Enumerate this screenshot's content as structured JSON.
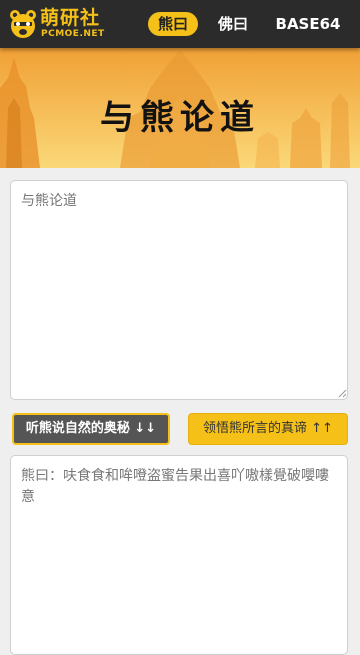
{
  "colors": {
    "accent": "#f5c018",
    "nav_bg": "#2b2b2b",
    "encode_btn_bg": "#555555"
  },
  "logo": {
    "title": "萌研社",
    "subtitle": "PCMOE.NET",
    "mascot_icon": "bear-mascot-icon"
  },
  "nav": {
    "tabs": [
      {
        "label": "熊曰",
        "active": true
      },
      {
        "label": "佛曰",
        "active": false
      },
      {
        "label": "BASE64",
        "active": false
      }
    ]
  },
  "hero": {
    "title": "与熊论道"
  },
  "input": {
    "placeholder": "与熊论道",
    "value": ""
  },
  "buttons": {
    "encode": "听熊说自然的奥秘 ↓↓",
    "decode": "领悟熊所言的真谛 ↑↑"
  },
  "output": {
    "value": "熊曰：呋食食和哞噔盗蜜告果出喜吖嗷樣覺破嚶嘍意"
  }
}
